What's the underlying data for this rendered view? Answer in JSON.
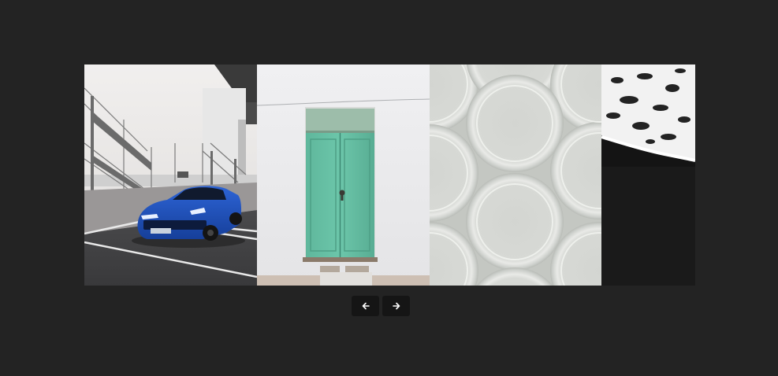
{
  "carousel": {
    "slides": [
      {
        "name": "blue-car-parking-lot"
      },
      {
        "name": "green-door-white-wall"
      },
      {
        "name": "white-paper-plates"
      },
      {
        "name": "black-sand-beach-waves"
      }
    ]
  },
  "navigation": {
    "prev_icon": "arrow-left-icon",
    "next_icon": "arrow-right-icon"
  },
  "colors": {
    "page_background": "#232323",
    "button_background": "#151515",
    "button_icon": "#ffffff"
  }
}
